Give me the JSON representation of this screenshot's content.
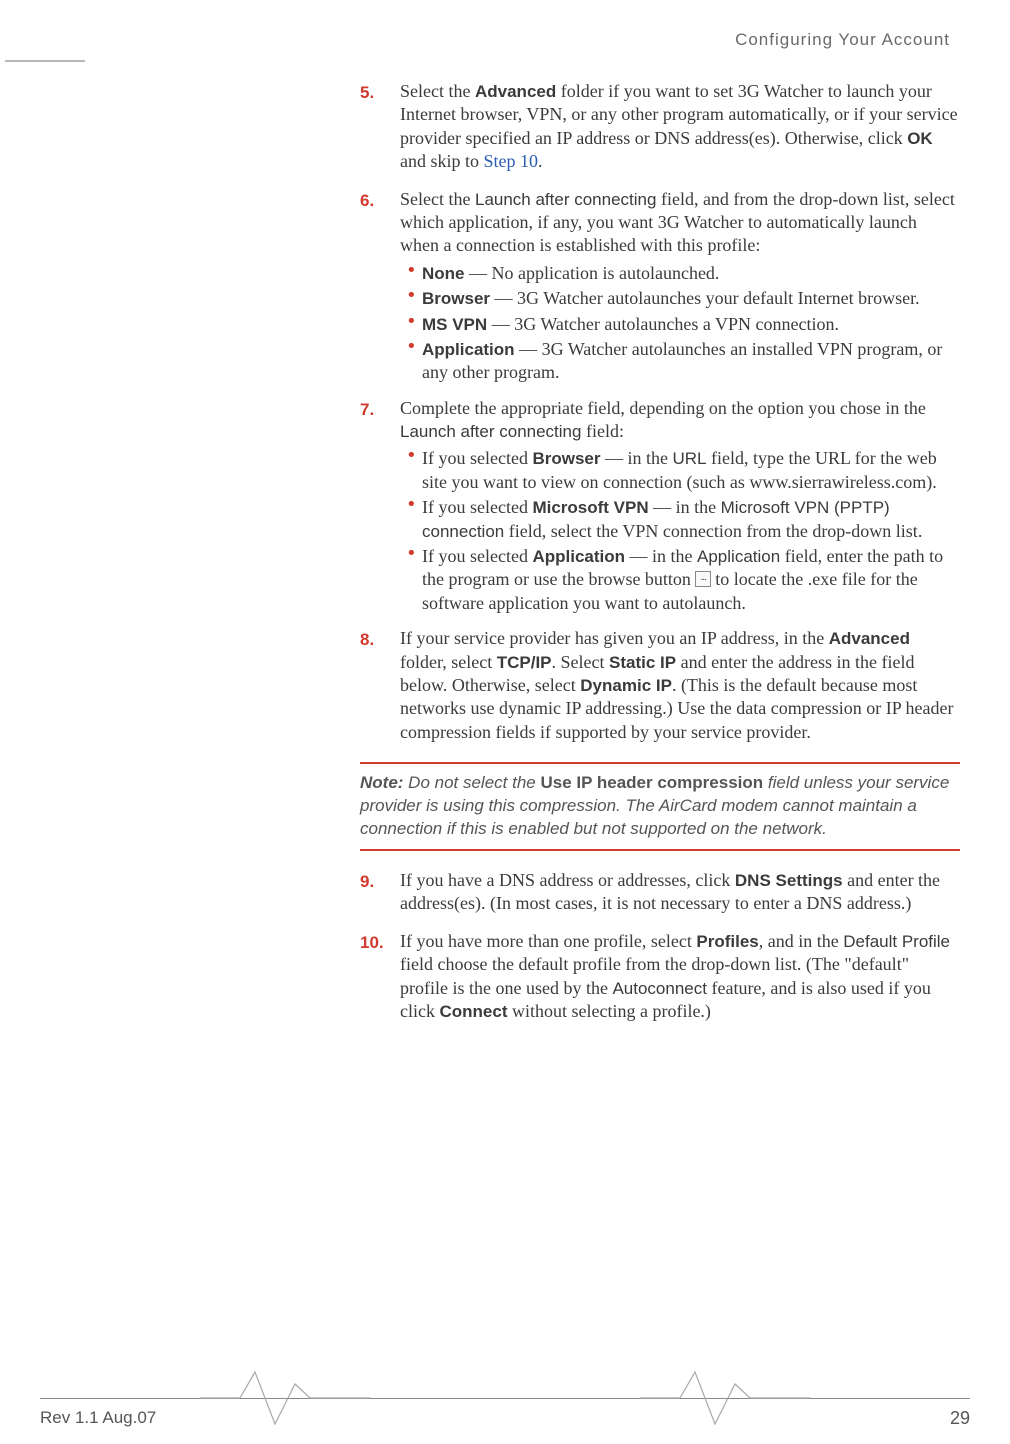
{
  "header": {
    "title": "Configuring Your Account"
  },
  "steps": {
    "s5": {
      "num": "5.",
      "t1": "Select the ",
      "b1": "Advanced",
      "t2": " folder if you want to set 3G Watcher to launch your Internet browser, VPN, or any other program automatically, or if your service provider specified an IP address or DNS address(es). Otherwise, click ",
      "b2": "OK",
      "t3": " and skip to ",
      "link": "Step 10",
      "t4": "."
    },
    "s6": {
      "num": "6.",
      "t1": "Select the ",
      "s1": "Launch after connecting",
      "t2": " field, and from the drop-down list, select which application, if any, you want 3G Watcher to automatically launch when a connection is established with this profile:",
      "items": [
        {
          "b": "None",
          "t": "— No application is autolaunched."
        },
        {
          "b": "Browser",
          "t": "— 3G Watcher autolaunches your default Internet browser."
        },
        {
          "b": "MS VPN",
          "t": "— 3G Watcher autolaunches a VPN connection."
        },
        {
          "b": "Application",
          "t": "— 3G Watcher autolaunches an installed VPN program, or any other program."
        }
      ]
    },
    "s7": {
      "num": "7.",
      "t1": "Complete the appropriate field, depending on the option you chose in the ",
      "s1": "Launch after connecting",
      "t2": " field:",
      "items": [
        {
          "pre": "If you selected ",
          "b": "Browser",
          "mid": " — in the ",
          "s": "URL",
          "post": " field, type the URL for the web site you want to view on connection (such as www.sierrawireless.com)."
        },
        {
          "pre": "If you selected ",
          "b": "Microsoft VPN",
          "mid": " — in the ",
          "s": "Microsoft VPN (PPTP) connection",
          "post": " field, select the VPN connection from the drop-down list."
        },
        {
          "pre": "If you selected ",
          "b": "Application",
          "mid": " — in the ",
          "s": "Application",
          "mid2": " field, enter the path to the program or use the browse button ",
          "post": " to locate the .exe file for the software application you want to autolaunch."
        }
      ]
    },
    "s8": {
      "num": "8.",
      "t1": "If your service provider has given you an IP address, in the ",
      "b1": "Advanced",
      "t2": " folder, select ",
      "b2": "TCP/IP",
      "t3": ". Select ",
      "b3": "Static IP",
      "t4": " and enter the address in the field below. Otherwise, select ",
      "b4": "Dynamic IP",
      "t5": ". (This is the default because most networks use dynamic IP addressing.) Use the data compression or IP header compression fields if supported by your service provider."
    },
    "note": {
      "label": "Note:  ",
      "t1": "Do not select the ",
      "b1": "Use IP header compression",
      "t2": " field unless your service provider is using this compression. The AirCard modem cannot maintain a connection if this is enabled but not supported on the network."
    },
    "s9": {
      "num": "9.",
      "t1": "If you have a DNS address or addresses, click ",
      "b1": "DNS Settings",
      "t2": " and enter the address(es). (In most cases, it is not necessary to enter a DNS address.)"
    },
    "s10": {
      "num": "10.",
      "t1": "If you have more than one profile, select ",
      "b1": "Profiles",
      "t2": ", and in the ",
      "s1": "Default Profile",
      "t3": " field choose the default profile from the drop-down list. (The \"default\" profile is the one used by the ",
      "s2": "Autoconnect",
      "t4": " feature, and is also used if you click ",
      "b2": "Connect",
      "t5": " without selecting a profile.)"
    }
  },
  "footer": {
    "left": "Rev 1.1 Aug.07",
    "right": "29"
  },
  "browse_icon": "..."
}
